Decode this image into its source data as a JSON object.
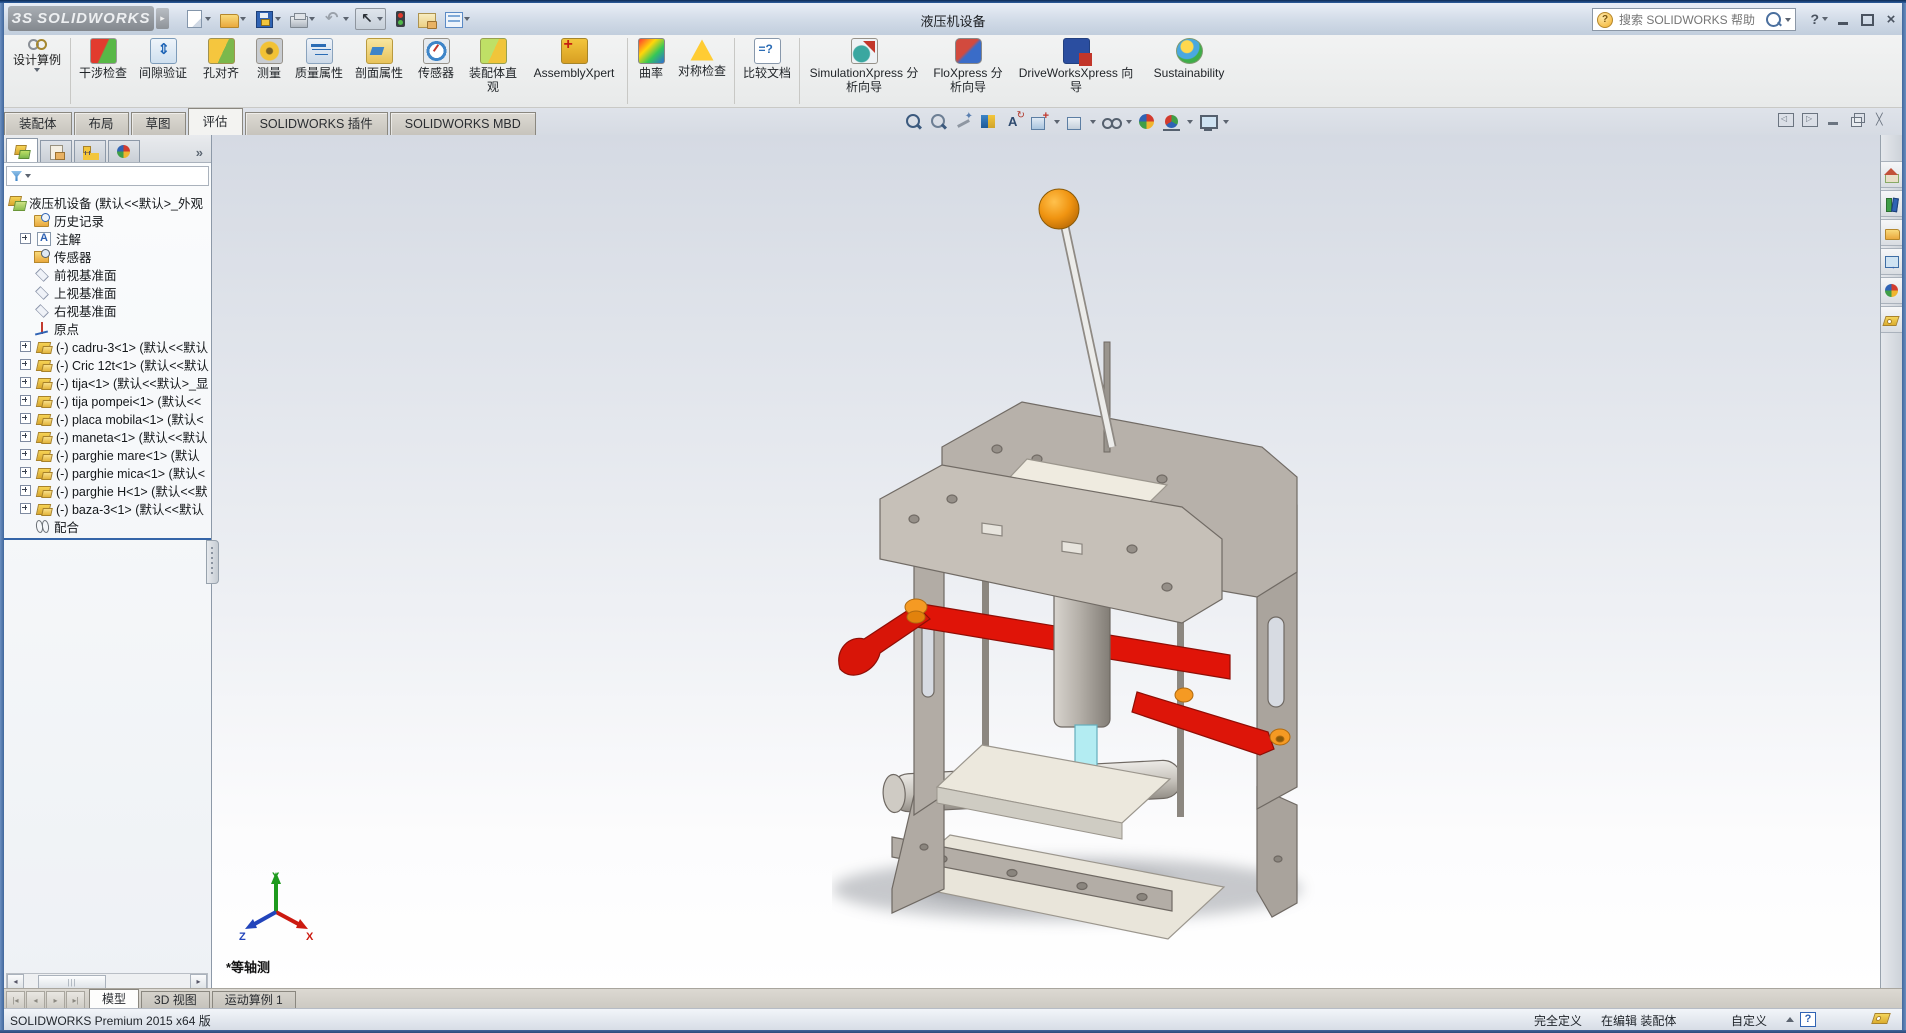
{
  "window": {
    "logo_mark": "ЗS",
    "logo_text": "SOLIDWORKS",
    "title": "液压机设备",
    "search_placeholder": "搜索 SOLIDWORKS 帮助"
  },
  "ribbon": {
    "design_study_label": "设计算例",
    "commands": [
      {
        "label": "干涉检查"
      },
      {
        "label": "间隙验证"
      },
      {
        "label": "孔对齐"
      },
      {
        "label": "测量"
      },
      {
        "label": "质量属性"
      },
      {
        "label": "剖面属性"
      },
      {
        "label": "传感器"
      },
      {
        "label": "装配体直观"
      },
      {
        "label": "AssemblyXpert"
      },
      {
        "label": "曲率"
      },
      {
        "label": "对称检查"
      },
      {
        "label": "比较文档"
      },
      {
        "label": "SimulationXpress 分析向导"
      },
      {
        "label": "FloXpress 分析向导"
      },
      {
        "label": "DriveWorksXpress 向导"
      },
      {
        "label": "Sustainability"
      }
    ],
    "tabs": [
      {
        "label": "装配体"
      },
      {
        "label": "布局"
      },
      {
        "label": "草图"
      },
      {
        "label": "评估"
      },
      {
        "label": "SOLIDWORKS 插件"
      },
      {
        "label": "SOLIDWORKS MBD"
      }
    ]
  },
  "feature_panel": {
    "root_label": "液压机设备 (默认<<默认>_外观",
    "items": [
      {
        "label": "历史记录"
      },
      {
        "label": "注解"
      },
      {
        "label": "传感器"
      },
      {
        "label": "前视基准面"
      },
      {
        "label": "上视基准面"
      },
      {
        "label": "右视基准面"
      },
      {
        "label": "原点"
      },
      {
        "label": "(-) cadru-3<1> (默认<<默认"
      },
      {
        "label": "(-) Cric 12t<1> (默认<<默认"
      },
      {
        "label": "(-) tija<1> (默认<<默认>_显"
      },
      {
        "label": "(-) tija pompei<1> (默认<<"
      },
      {
        "label": "(-) placa mobila<1> (默认<"
      },
      {
        "label": "(-) maneta<1> (默认<<默认"
      },
      {
        "label": "(-) parghie mare<1> (默认"
      },
      {
        "label": "(-) parghie mica<1> (默认<"
      },
      {
        "label": "(-) parghie H<1> (默认<<默"
      },
      {
        "label": "(-) baza-3<1> (默认<<默认"
      },
      {
        "label": "配合"
      }
    ]
  },
  "viewport": {
    "view_label": "*等轴测",
    "triad": {
      "x": "X",
      "y": "Y",
      "z": "Z"
    }
  },
  "bottom_tabs": [
    {
      "label": "模型"
    },
    {
      "label": "3D 视图"
    },
    {
      "label": "运动算例 1"
    }
  ],
  "status_bar": {
    "app_version": "SOLIDWORKS Premium 2015 x64 版",
    "define_state": "完全定义",
    "editing_state": "在编辑 装配体",
    "custom_label": "自定义"
  },
  "colors": {
    "accent_red": "#e01408",
    "accent_orange": "#f59a23",
    "accent_cyan": "#b3ecf2",
    "frame_gray": "#b7b1aa",
    "viewport_top": "#d7dce5",
    "viewport_bottom": "#ffffff"
  }
}
